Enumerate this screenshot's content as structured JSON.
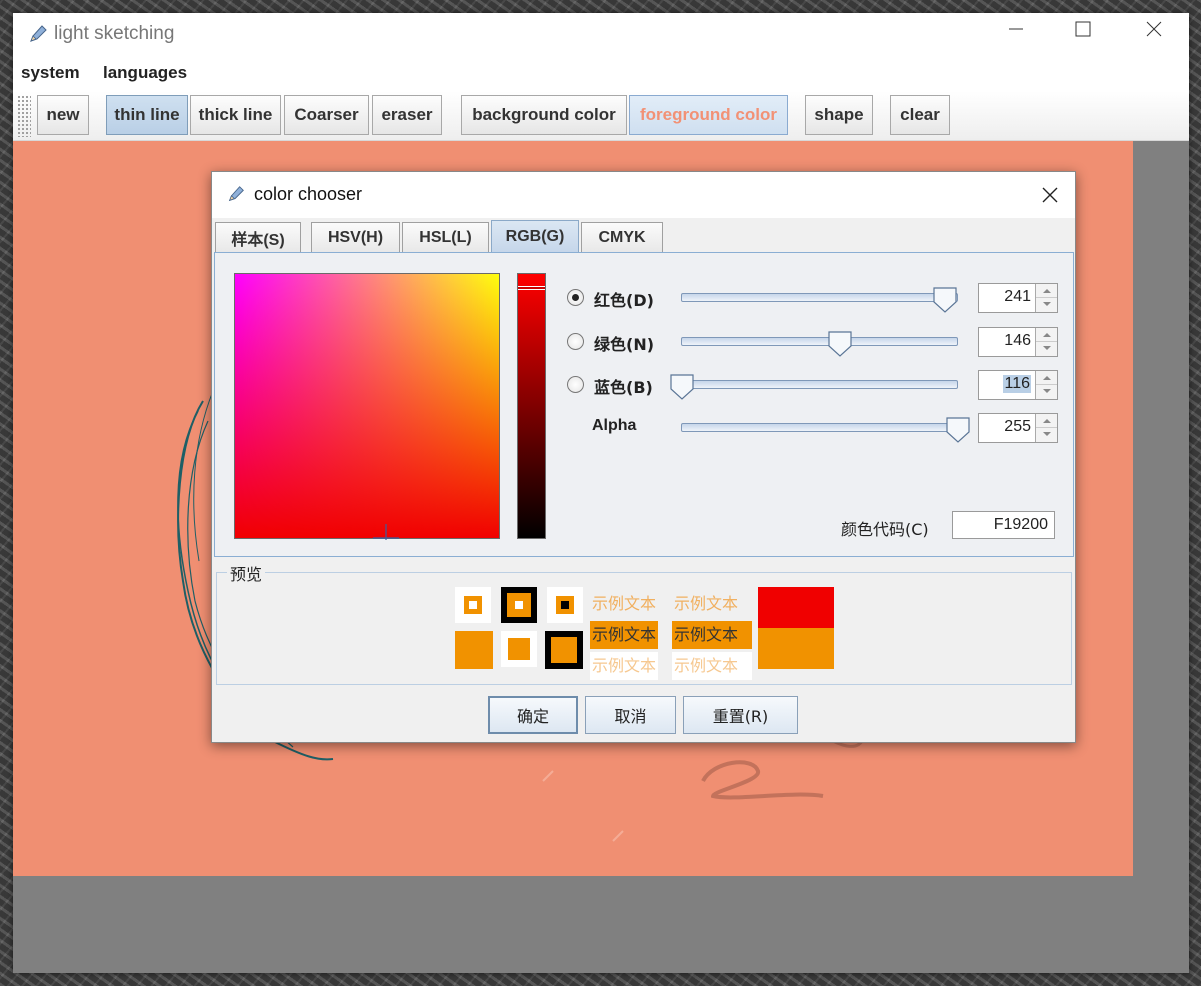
{
  "app": {
    "title": "light sketching",
    "menu": [
      "system",
      "languages"
    ],
    "toolbar": {
      "new": "new",
      "thin_line": "thin line",
      "thick_line": "thick line",
      "coarser": "Coarser",
      "eraser": "eraser",
      "background_color": "background color",
      "foreground_color": "foreground color",
      "shape": "shape",
      "clear": "clear"
    },
    "colors": {
      "canvas": "#f08f72",
      "workarea": "#808080",
      "foreground_label": "#f29175"
    }
  },
  "dialog": {
    "title": "color chooser",
    "tabs": [
      "样本(S)",
      "HSV(H)",
      "HSL(L)",
      "RGB(G)",
      "CMYK"
    ],
    "active_tab": "RGB(G)",
    "channels": [
      {
        "label": "红色(D)",
        "value": "241",
        "selected": true
      },
      {
        "label": "绿色(N)",
        "value": "146",
        "selected": false
      },
      {
        "label": "蓝色(B)",
        "value": "116",
        "selected": false
      },
      {
        "label": "Alpha",
        "value": "255",
        "selected": false
      }
    ],
    "color_code_label": "颜色代码(C)",
    "color_code": "F19200",
    "preview_label": "预览",
    "sample_text": "示例文本",
    "preview_colors": {
      "selected": "#f19200",
      "previous": "#f00000"
    },
    "buttons": {
      "ok": "确定",
      "cancel": "取消",
      "reset": "重置(R)"
    }
  }
}
